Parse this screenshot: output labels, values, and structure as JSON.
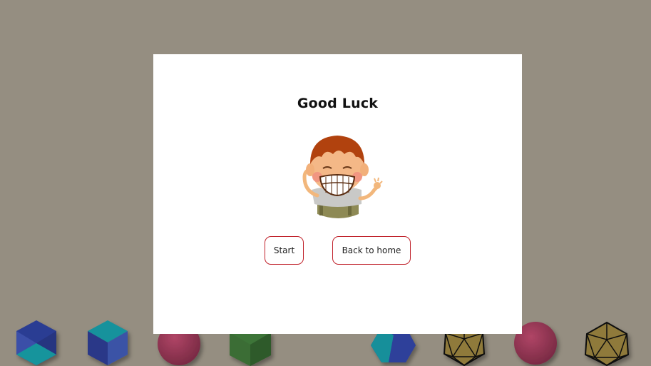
{
  "dialog": {
    "title": "Good Luck",
    "start_label": "Start",
    "home_label": "Back to home"
  },
  "colors": {
    "background": "#958e81",
    "button_border": "#c0222b",
    "blue_shape": "#2f3f9a",
    "teal_shape": "#168f9a",
    "pink_shape": "#8e3550",
    "green_shape": "#3a6a36",
    "gold_shape": "#8f7a3a"
  },
  "icons": {
    "character": "smiling-boy-illustration",
    "shapes": [
      "cube",
      "cube",
      "sphere",
      "cube",
      "cube",
      "icosahedron",
      "sphere",
      "icosahedron"
    ]
  }
}
